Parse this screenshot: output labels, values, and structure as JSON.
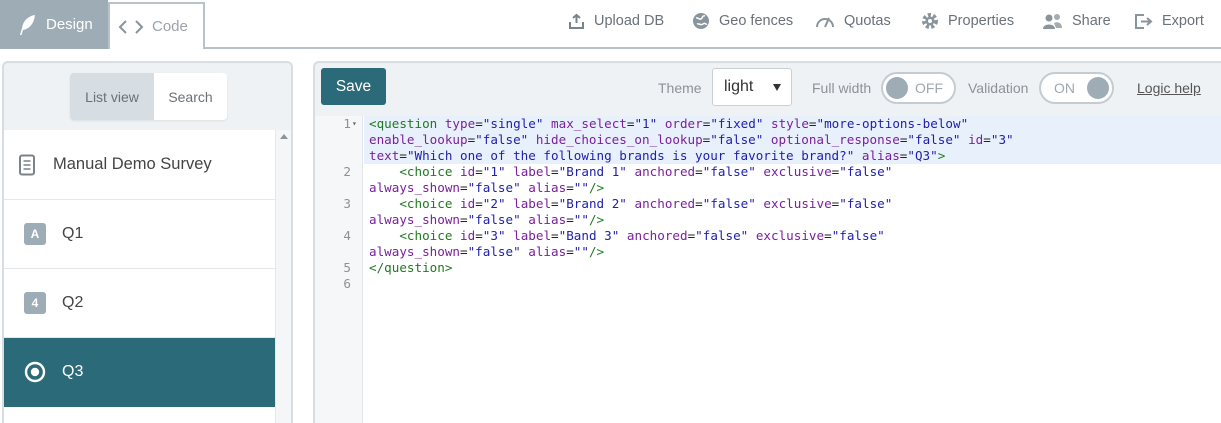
{
  "topbar": {
    "modes": {
      "design": "Design",
      "code": "Code"
    },
    "actions": [
      {
        "label": "Upload DB",
        "icon": "upload-icon"
      },
      {
        "label": "Geo fences",
        "icon": "globe-icon"
      },
      {
        "label": "Quotas",
        "icon": "gauge-icon"
      },
      {
        "label": "Properties",
        "icon": "gear-icon"
      },
      {
        "label": "Share",
        "icon": "users-icon"
      },
      {
        "label": "Export",
        "icon": "export-icon"
      }
    ]
  },
  "left": {
    "view_list": "List view",
    "view_search": "Search",
    "items": [
      {
        "label": "Manual Demo Survey",
        "icon": "document-icon"
      },
      {
        "label": "Q1",
        "badge": "A",
        "icon": "text-question-icon"
      },
      {
        "label": "Q2",
        "badge": "4",
        "icon": "number-question-icon"
      },
      {
        "label": "Q3",
        "icon": "radio-question-icon",
        "active": true
      }
    ]
  },
  "editor_toolbar": {
    "save": "Save",
    "theme_label": "Theme",
    "theme_value": "light",
    "full_width_label": "Full width",
    "full_width_state": "OFF",
    "validation_label": "Validation",
    "validation_state": "ON",
    "logic_help": "Logic help"
  },
  "code": {
    "lines": [
      {
        "n": "1",
        "fold": "▾",
        "highlight": true,
        "text": [
          "<question type=\"single\" max_select=\"1\" order=\"fixed\" style=\"more-options-below\"",
          "enable_lookup=\"false\" hide_choices_on_lookup=\"false\" optional_response=\"false\" id=\"3\"",
          "text=\"Which one of the following brands is your favorite brand?\" alias=\"Q3\">"
        ]
      },
      {
        "n": "2",
        "text": [
          "    <choice id=\"1\" label=\"Brand 1\" anchored=\"false\" exclusive=\"false\"",
          "always_shown=\"false\" alias=\"\"/>"
        ]
      },
      {
        "n": "3",
        "text": [
          "    <choice id=\"2\" label=\"Brand 2\" anchored=\"false\" exclusive=\"false\"",
          "always_shown=\"false\" alias=\"\"/>"
        ]
      },
      {
        "n": "4",
        "text": [
          "    <choice id=\"3\" label=\"Band 3\" anchored=\"false\" exclusive=\"false\"",
          "always_shown=\"false\" alias=\"\"/>"
        ]
      },
      {
        "n": "5",
        "text": [
          "</question>"
        ]
      },
      {
        "n": "6",
        "text": [
          ""
        ]
      }
    ]
  }
}
